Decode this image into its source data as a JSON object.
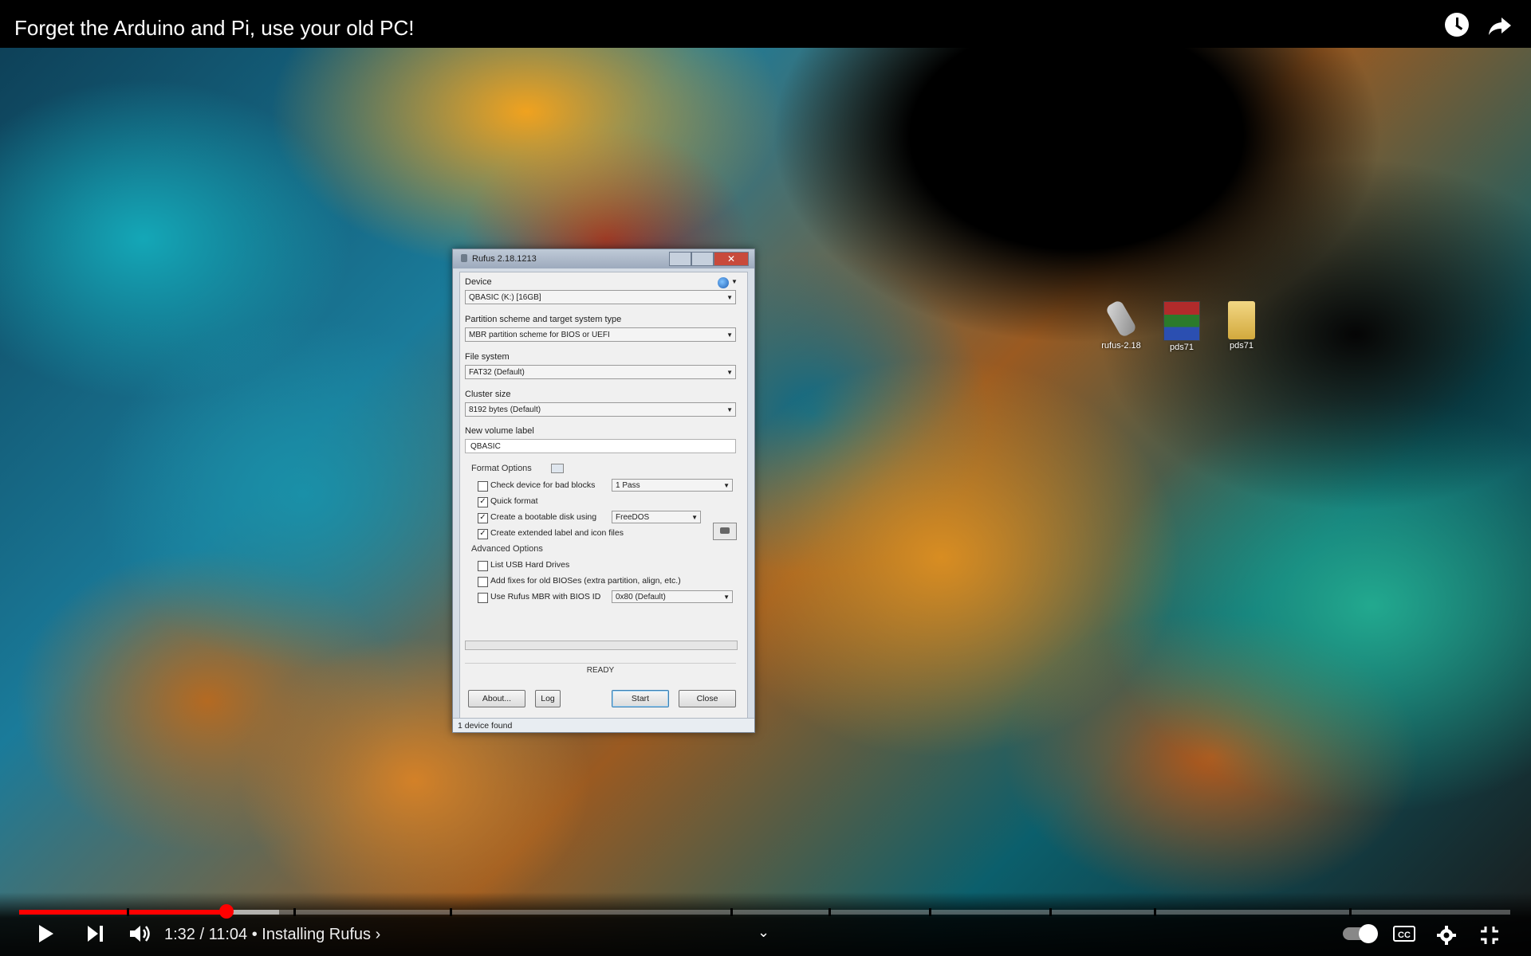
{
  "video": {
    "title": "Forget the Arduino and Pi, use your old PC!",
    "time": "1:32 / 11:04",
    "chapter": "• Installing Rufus",
    "chapter_arrow": "›",
    "progress_fraction": 0.1391,
    "buffered_fraction": 0.1745,
    "chapter_marks_fraction": [
      0.072,
      0.184,
      0.289,
      0.477,
      0.543,
      0.61,
      0.691,
      0.761,
      0.892
    ]
  },
  "desktop": {
    "icons": [
      {
        "label": "rufus-2.18",
        "icon": "usb-drive-icon"
      },
      {
        "label": "pds71",
        "icon": "winrar-archive-icon"
      },
      {
        "label": "pds71",
        "icon": "folder-icon"
      }
    ]
  },
  "dialog": {
    "title": "Rufus 2.18.1213",
    "device_label": "Device",
    "device_value": "QBASIC (K:) [16GB]",
    "partition_label": "Partition scheme and target system type",
    "partition_value": "MBR partition scheme for BIOS or UEFI",
    "fs_label": "File system",
    "fs_value": "FAT32 (Default)",
    "cluster_label": "Cluster size",
    "cluster_value": "8192 bytes (Default)",
    "volume_label": "New volume label",
    "volume_value": "QBASIC",
    "format_options": "Format Options",
    "check_bad_blocks": "Check device for bad blocks",
    "passes_value": "1 Pass",
    "quick_format": "Quick format",
    "bootable": "Create a bootable disk using",
    "bootable_value": "FreeDOS",
    "extended_label": "Create extended label and icon files",
    "advanced_options": "Advanced Options",
    "list_usb": "List USB Hard Drives",
    "add_fixes": "Add fixes for old BIOSes (extra partition, align, etc.)",
    "use_rufus_mbr": "Use Rufus MBR with BIOS ID",
    "bios_id_value": "0x80 (Default)",
    "status": "READY",
    "progress_fraction": 0,
    "about_button": "About...",
    "log_button": "Log",
    "start_button": "Start",
    "close_button": "Close",
    "statusbar": "1 device found",
    "checks": {
      "bad_blocks": false,
      "quick_format": true,
      "bootable": true,
      "extended": true,
      "list_usb": false,
      "add_fixes": false,
      "rufus_mbr": false
    }
  }
}
